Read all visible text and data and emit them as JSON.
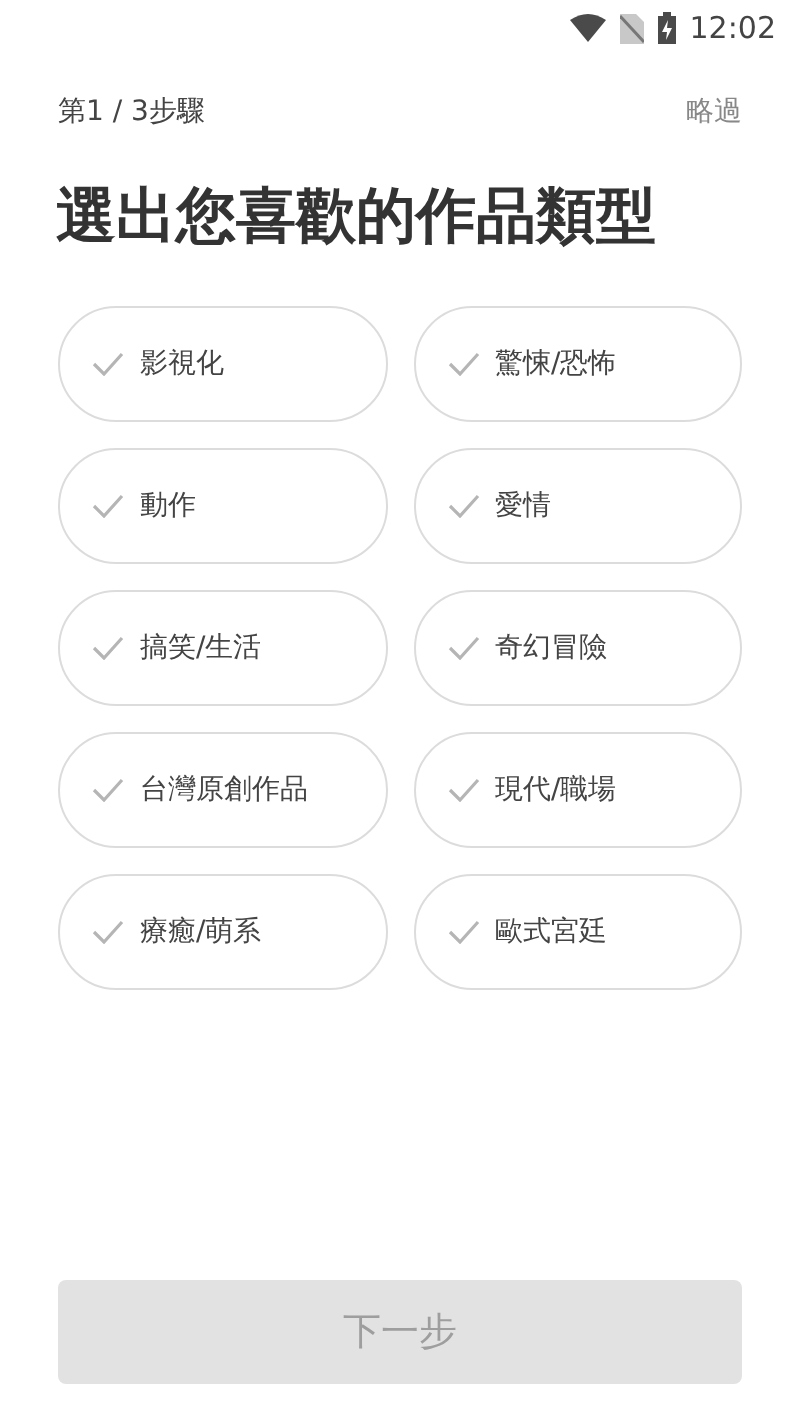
{
  "status_bar": {
    "time": "12:02"
  },
  "header": {
    "step": "第1 / 3步驟",
    "skip": "略過"
  },
  "title": "選出您喜歡的作品類型",
  "options": [
    {
      "label": "影視化",
      "selected": false
    },
    {
      "label": "驚悚/恐怖",
      "selected": false
    },
    {
      "label": "動作",
      "selected": false
    },
    {
      "label": "愛情",
      "selected": false
    },
    {
      "label": "搞笑/生活",
      "selected": false
    },
    {
      "label": "奇幻冒險",
      "selected": false
    },
    {
      "label": "台灣原創作品",
      "selected": false
    },
    {
      "label": "現代/職場",
      "selected": false
    },
    {
      "label": "療癒/萌系",
      "selected": false
    },
    {
      "label": "歐式宮廷",
      "selected": false
    }
  ],
  "next_button": {
    "label": "下一步",
    "disabled": true
  }
}
